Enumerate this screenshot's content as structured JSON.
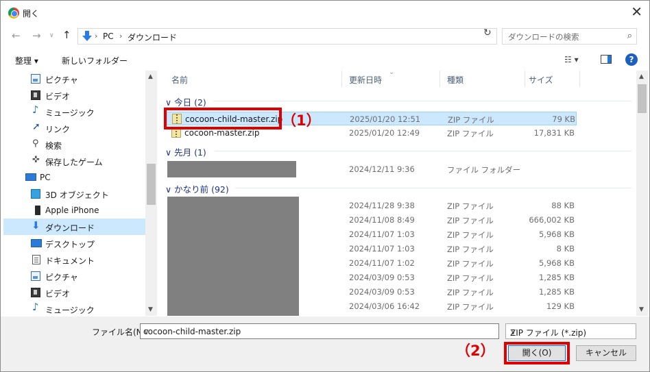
{
  "window": {
    "title": "開く",
    "close_glyph": "✕"
  },
  "nav": {
    "back_glyph": "←",
    "forward_glyph": "→",
    "up_glyph": "↑"
  },
  "address": {
    "crumbs": [
      "PC",
      "ダウンロード"
    ],
    "sep": "›",
    "dropdown_glyph": "∨",
    "refresh_glyph": "↻"
  },
  "search": {
    "placeholder": "ダウンロードの検索",
    "icon_glyph": "⌕"
  },
  "toolbar": {
    "organize": "整理 ▾",
    "new_folder": "新しいフォルダー",
    "view_glyph": "☷ ▾",
    "help_glyph": "?"
  },
  "sidebar": {
    "items": [
      {
        "label": "ピクチャ",
        "icon": "pictures-icon"
      },
      {
        "label": "ビデオ",
        "icon": "videos-icon"
      },
      {
        "label": "ミュージック",
        "icon": "music-icon",
        "glyph": "♪"
      },
      {
        "label": "リンク",
        "icon": "link-icon",
        "glyph": "➚"
      },
      {
        "label": "検索",
        "icon": "search-icon",
        "glyph": "⚲"
      },
      {
        "label": "保存したゲーム",
        "icon": "game-icon",
        "glyph": "✜"
      },
      {
        "label": "PC",
        "icon": "pc-icon"
      },
      {
        "label": "3D オブジェクト",
        "icon": "3d-objects-icon"
      },
      {
        "label": "Apple iPhone",
        "icon": "phone-icon"
      },
      {
        "label": "ダウンロード",
        "icon": "download-icon",
        "glyph": "⬇",
        "selected": true
      },
      {
        "label": "デスクトップ",
        "icon": "desktop-icon"
      },
      {
        "label": "ドキュメント",
        "icon": "documents-icon"
      },
      {
        "label": "ピクチャ",
        "icon": "pictures-icon"
      },
      {
        "label": "ビデオ",
        "icon": "videos-icon"
      },
      {
        "label": "ミュージック",
        "icon": "music-icon",
        "glyph": "♪"
      }
    ]
  },
  "columns": {
    "name": "名前",
    "date": "更新日時",
    "type": "種類",
    "size": "サイズ",
    "sort_glyph": "⌄"
  },
  "groups": {
    "today": "∨ 今日 (2)",
    "last_month": "∨ 先月 (1)",
    "long_ago": "∨ かなり前 (92)"
  },
  "files_today": [
    {
      "name": "cocoon-child-master.zip",
      "date": "2025/01/20 12:51",
      "type": "ZIP ファイル",
      "size": "79 KB",
      "selected": true
    },
    {
      "name": "cocoon-master.zip",
      "date": "2025/01/20 12:49",
      "type": "ZIP ファイル",
      "size": "17,831 KB"
    }
  ],
  "files_last_month": [
    {
      "date": "2024/12/11 9:36",
      "type": "ファイル フォルダー",
      "size": ""
    }
  ],
  "files_long_ago": [
    {
      "date": "2024/11/28 9:38",
      "type": "ZIP ファイル",
      "size": "88 KB"
    },
    {
      "date": "2024/11/08 8:49",
      "type": "ZIP ファイル",
      "size": "666,002 KB"
    },
    {
      "date": "2024/11/07 1:03",
      "type": "ZIP ファイル",
      "size": "5,968 KB"
    },
    {
      "date": "2024/11/07 1:03",
      "type": "ZIP ファイル",
      "size": "8 KB"
    },
    {
      "date": "2024/11/07 1:02",
      "type": "ZIP ファイル",
      "size": "5,968 KB"
    },
    {
      "date": "2024/03/09 0:53",
      "type": "ZIP ファイル",
      "size": "1,285 KB"
    },
    {
      "date": "2024/03/09 0:53",
      "type": "ZIP ファイル",
      "size": "1,285 KB"
    },
    {
      "date": "2024/03/06 16:42",
      "type": "ZIP ファイル",
      "size": "129 KB"
    }
  ],
  "annotations": {
    "step1": "（1）",
    "step2": "（2）",
    "highlight_color": "#e00000"
  },
  "footer": {
    "filename_label": "ファイル名(N):",
    "filename_value": "cocoon-child-master.zip",
    "filetype_value": "ZIP ファイル (*.zip)",
    "open_label": "開く(O)",
    "cancel_label": "キャンセル"
  },
  "scroll": {
    "up_glyph": "▲",
    "down_glyph": "▼"
  }
}
